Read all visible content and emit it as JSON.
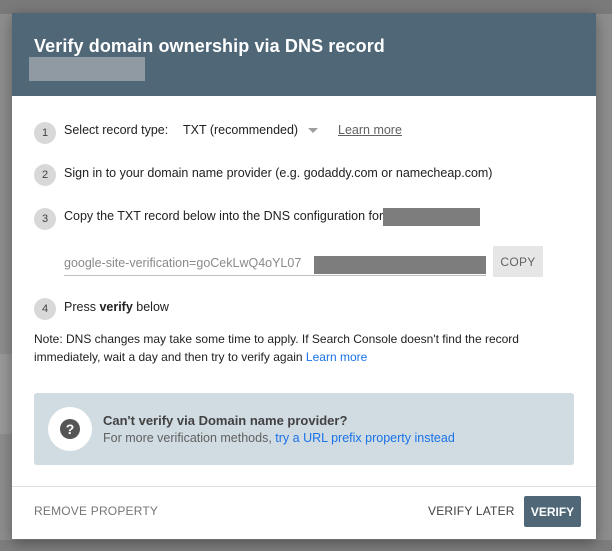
{
  "dialog": {
    "title": "Verify domain ownership via DNS record",
    "header_bg": "#4f6777"
  },
  "steps": [
    {
      "number": "1",
      "text": "Select record type:"
    },
    {
      "number": "2",
      "text": "Sign in to your domain name provider (e.g. godaddy.com or namecheap.com)"
    },
    {
      "number": "3",
      "text": "Copy the TXT record below into the DNS configuration for"
    },
    {
      "number": "4",
      "text_before": "Press ",
      "text_bold": "verify",
      "text_after": " below"
    }
  ],
  "record_type": {
    "selected": "TXT (recommended)",
    "learn_more": "Learn more"
  },
  "txt_record": {
    "value_visible": "google-site-verification=goCekLwQ4oYL07",
    "copy_label": "COPY"
  },
  "note": {
    "text": "Note: DNS changes may take some time to apply. If Search Console doesn't find the record immediately, wait a day and then try to verify again",
    "link": "Learn more"
  },
  "info_box": {
    "title": "Can't verify via Domain name provider?",
    "sub_text": "For more verification methods, ",
    "sub_link": "try a URL prefix property instead",
    "icon": "help-icon"
  },
  "footer": {
    "remove_label": "REMOVE PROPERTY",
    "later_label": "VERIFY LATER",
    "verify_label": "VERIFY"
  },
  "colors": {
    "accent": "#4f6777",
    "link": "#1a73e8",
    "info_bg": "#d0dbe2"
  }
}
